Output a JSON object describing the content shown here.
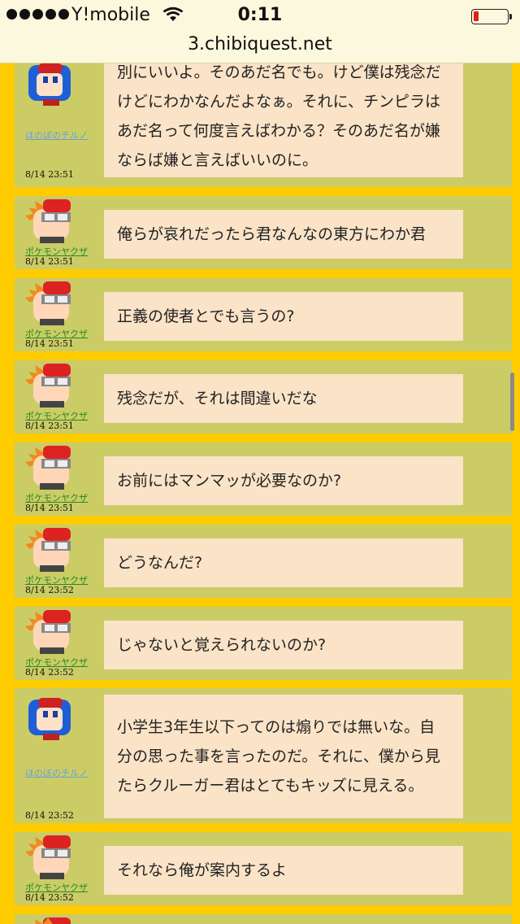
{
  "status": {
    "carrier": "Y!mobile",
    "time": "0:11"
  },
  "url": "3.chibiquest.net",
  "posts": [
    {
      "user": "ほのぼのチルノ",
      "time": "8/14 23:51",
      "text": "別にいいよ。そのあだ名でも。けど僕は残念だけどにわかなんだよなぁ。それに、チンピラはあだ名って何度言えばわかる？そのあだ名が嫌ならば嫌と言えばいいのに。"
    },
    {
      "user": "ポケモンヤクザ",
      "time": "8/14 23:51",
      "text": "俺らが哀れだったら君なんなの東方にわか君"
    },
    {
      "user": "ポケモンヤクザ",
      "time": "8/14 23:51",
      "text": "正義の使者とでも言うの?"
    },
    {
      "user": "ポケモンヤクザ",
      "time": "8/14 23:51",
      "text": "残念だが、それは間違いだな"
    },
    {
      "user": "ポケモンヤクザ",
      "time": "8/14 23:51",
      "text": "お前にはマンマッが必要なのか?"
    },
    {
      "user": "ポケモンヤクザ",
      "time": "8/14 23:52",
      "text": "どうなんだ?"
    },
    {
      "user": "ポケモンヤクザ",
      "time": "8/14 23:52",
      "text": "じゃないと覚えられないのか?"
    },
    {
      "user": "ほのぼのチルノ",
      "time": "8/14 23:52",
      "text": "小学生3年生以下ってのは煽りでは無いな。自分の思った事を言ったのだ。それに、僕から見たらクルーガー君はとてもキッズに見える。"
    },
    {
      "user": "ポケモンヤクザ",
      "time": "8/14 23:52",
      "text": "それなら俺が案内するよ"
    }
  ]
}
